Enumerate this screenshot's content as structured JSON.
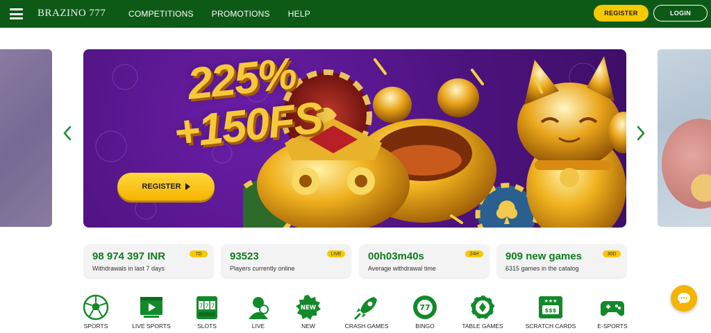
{
  "header": {
    "logo": "BRAZINO 777",
    "nav": [
      "COMPETITIONS",
      "PROMOTIONS",
      "HELP"
    ],
    "register_label": "REGISTER",
    "login_label": "LOGIN",
    "bg_color": "#0d5a17",
    "accent_color": "#f8c800"
  },
  "banner": {
    "promo_line1": "225%",
    "promo_line2": "+150FS",
    "register_label": "REGISTER"
  },
  "stats": [
    {
      "value": "98 974 397 INR",
      "label": "Withdrawals in last 7 days",
      "badge": "7D"
    },
    {
      "value": "93523",
      "label": "Players currently online",
      "badge": "LIVE"
    },
    {
      "value": "00h03m40s",
      "label": "Average withdrawal time",
      "badge": "24H"
    },
    {
      "value": "909 new games",
      "label": "6315 games in the catalog",
      "badge": "30D"
    }
  ],
  "categories": [
    {
      "label": "SPORTS",
      "icon": "soccer-ball-icon"
    },
    {
      "label": "LIVE SPORTS",
      "icon": "live-screen-icon"
    },
    {
      "label": "SLOTS",
      "icon": "slot-machine-icon"
    },
    {
      "label": "LIVE",
      "icon": "dealer-icon"
    },
    {
      "label": "NEW",
      "icon": "new-badge-icon"
    },
    {
      "label": "CRASH GAMES",
      "icon": "rocket-icon"
    },
    {
      "label": "BINGO",
      "icon": "bingo-ball-icon"
    },
    {
      "label": "TABLE GAMES",
      "icon": "casino-chip-icon"
    },
    {
      "label": "SCRATCH CARDS",
      "icon": "scratch-card-icon"
    },
    {
      "label": "E-SPORTS",
      "icon": "gamepad-icon"
    }
  ],
  "category_badges": {
    "new_badge": "NEW",
    "bingo_number": "77"
  }
}
